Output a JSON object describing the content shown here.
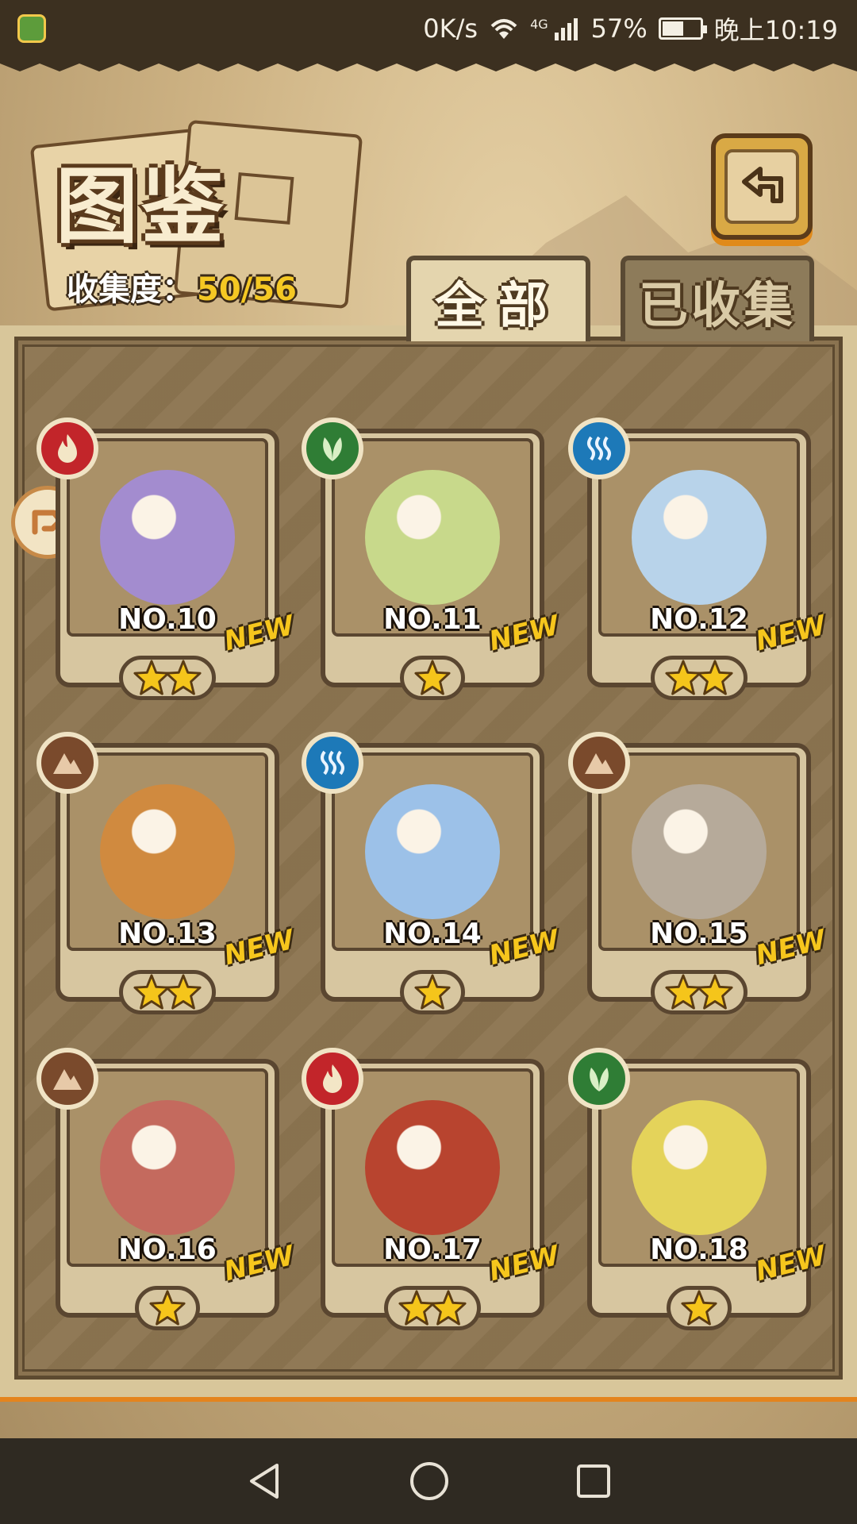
{
  "status_bar": {
    "net_speed": "0K/s",
    "signal": "4G",
    "battery": "57%",
    "battery_level": 0.57,
    "time": "晚上10:19"
  },
  "header": {
    "title": "图鉴",
    "collection_label": "收集度：",
    "collection_value": "50/56"
  },
  "tabs": [
    {
      "label": "全部",
      "active": true
    },
    {
      "label": "已收集",
      "active": false
    }
  ],
  "cards": [
    {
      "number": "NO.10",
      "element": "fire",
      "stars": 2,
      "badge": "NEW",
      "color": "#a38ccf"
    },
    {
      "number": "NO.11",
      "element": "leaf",
      "stars": 1,
      "badge": "NEW",
      "color": "#c8d98b"
    },
    {
      "number": "NO.12",
      "element": "water",
      "stars": 2,
      "badge": "NEW",
      "color": "#b8d3ea"
    },
    {
      "number": "NO.13",
      "element": "earth",
      "stars": 2,
      "badge": "NEW",
      "color": "#d08a3f"
    },
    {
      "number": "NO.14",
      "element": "water",
      "stars": 1,
      "badge": "NEW",
      "color": "#9cc1e8"
    },
    {
      "number": "NO.15",
      "element": "earth",
      "stars": 2,
      "badge": "NEW",
      "color": "#b6aa9a"
    },
    {
      "number": "NO.16",
      "element": "earth",
      "stars": 1,
      "badge": "NEW",
      "color": "#c46a5e"
    },
    {
      "number": "NO.17",
      "element": "fire",
      "stars": 2,
      "badge": "NEW",
      "color": "#b8442f"
    },
    {
      "number": "NO.18",
      "element": "leaf",
      "stars": 1,
      "badge": "NEW",
      "color": "#e4d35a"
    }
  ],
  "colors": {
    "star": "#f5c51b",
    "new_badge": "#f6c61d",
    "collect_value": "#f5c823"
  }
}
